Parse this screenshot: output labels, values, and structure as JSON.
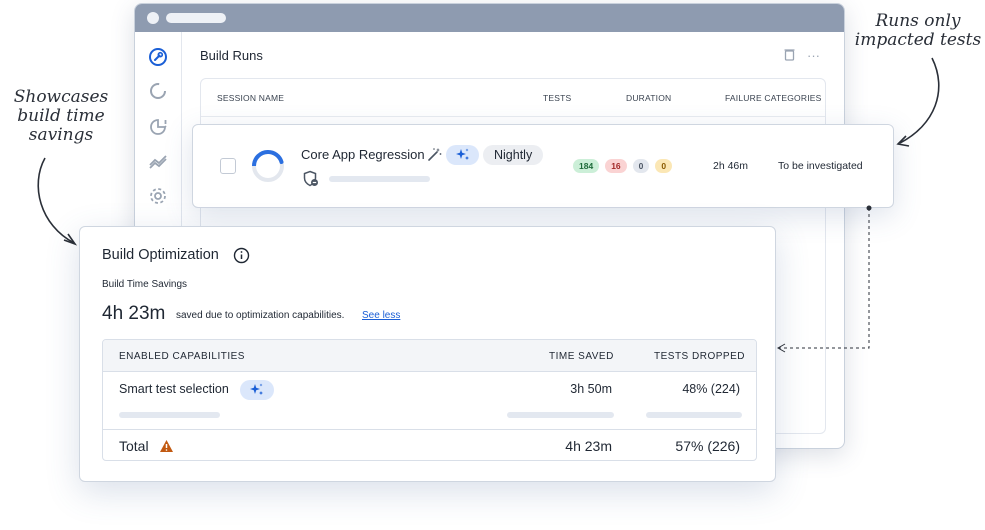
{
  "colors": {
    "accent": "#1b5fd6",
    "ai_pill_bg": "#dbe7fb",
    "warning": "#c25a12"
  },
  "window": {
    "page_title": "Build Runs",
    "sidebar_icons": [
      "wrench-icon",
      "progress-ring-icon",
      "pie-alert-icon",
      "trend-chart-icon",
      "gear-icon"
    ],
    "table_headers": {
      "session_name": "SESSION NAME",
      "tests": "TESTS",
      "duration": "DURATION",
      "failure_categories": "FAILURE CATEGORIES"
    }
  },
  "run": {
    "name": "Core App Regression",
    "tag": "Nightly",
    "badges": [
      "184",
      "16",
      "0",
      "0"
    ],
    "duration": "2h 46m",
    "failure_category": "To be investigated"
  },
  "optimization": {
    "title": "Build Optimization",
    "subtitle": "Build Time Savings",
    "total_saved": "4h 23m",
    "saved_text": "saved due to optimization capabilities.",
    "link_text": "See less",
    "headers": {
      "capabilities": "ENABLED CAPABILITIES",
      "time_saved": "TIME SAVED",
      "tests_dropped": "TESTS DROPPED"
    },
    "rows": [
      {
        "name": "Smart test selection",
        "time_saved": "3h 50m",
        "tests_dropped": "48% (224)"
      }
    ],
    "total": {
      "label": "Total",
      "time_saved": "4h 23m",
      "tests_dropped": "57% (226)"
    }
  },
  "annotations": {
    "left": [
      "Showcases",
      "build time",
      "savings"
    ],
    "right": [
      "Runs only",
      "impacted tests"
    ]
  }
}
